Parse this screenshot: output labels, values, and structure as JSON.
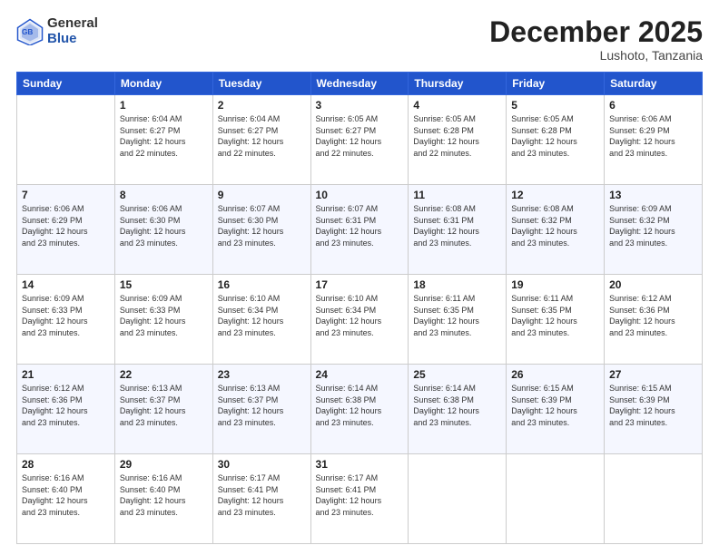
{
  "header": {
    "logo_general": "General",
    "logo_blue": "Blue",
    "month": "December 2025",
    "location": "Lushoto, Tanzania"
  },
  "weekdays": [
    "Sunday",
    "Monday",
    "Tuesday",
    "Wednesday",
    "Thursday",
    "Friday",
    "Saturday"
  ],
  "weeks": [
    [
      {
        "day": "",
        "info": ""
      },
      {
        "day": "1",
        "info": "Sunrise: 6:04 AM\nSunset: 6:27 PM\nDaylight: 12 hours\nand 22 minutes."
      },
      {
        "day": "2",
        "info": "Sunrise: 6:04 AM\nSunset: 6:27 PM\nDaylight: 12 hours\nand 22 minutes."
      },
      {
        "day": "3",
        "info": "Sunrise: 6:05 AM\nSunset: 6:27 PM\nDaylight: 12 hours\nand 22 minutes."
      },
      {
        "day": "4",
        "info": "Sunrise: 6:05 AM\nSunset: 6:28 PM\nDaylight: 12 hours\nand 22 minutes."
      },
      {
        "day": "5",
        "info": "Sunrise: 6:05 AM\nSunset: 6:28 PM\nDaylight: 12 hours\nand 23 minutes."
      },
      {
        "day": "6",
        "info": "Sunrise: 6:06 AM\nSunset: 6:29 PM\nDaylight: 12 hours\nand 23 minutes."
      }
    ],
    [
      {
        "day": "7",
        "info": "Sunrise: 6:06 AM\nSunset: 6:29 PM\nDaylight: 12 hours\nand 23 minutes."
      },
      {
        "day": "8",
        "info": "Sunrise: 6:06 AM\nSunset: 6:30 PM\nDaylight: 12 hours\nand 23 minutes."
      },
      {
        "day": "9",
        "info": "Sunrise: 6:07 AM\nSunset: 6:30 PM\nDaylight: 12 hours\nand 23 minutes."
      },
      {
        "day": "10",
        "info": "Sunrise: 6:07 AM\nSunset: 6:31 PM\nDaylight: 12 hours\nand 23 minutes."
      },
      {
        "day": "11",
        "info": "Sunrise: 6:08 AM\nSunset: 6:31 PM\nDaylight: 12 hours\nand 23 minutes."
      },
      {
        "day": "12",
        "info": "Sunrise: 6:08 AM\nSunset: 6:32 PM\nDaylight: 12 hours\nand 23 minutes."
      },
      {
        "day": "13",
        "info": "Sunrise: 6:09 AM\nSunset: 6:32 PM\nDaylight: 12 hours\nand 23 minutes."
      }
    ],
    [
      {
        "day": "14",
        "info": "Sunrise: 6:09 AM\nSunset: 6:33 PM\nDaylight: 12 hours\nand 23 minutes."
      },
      {
        "day": "15",
        "info": "Sunrise: 6:09 AM\nSunset: 6:33 PM\nDaylight: 12 hours\nand 23 minutes."
      },
      {
        "day": "16",
        "info": "Sunrise: 6:10 AM\nSunset: 6:34 PM\nDaylight: 12 hours\nand 23 minutes."
      },
      {
        "day": "17",
        "info": "Sunrise: 6:10 AM\nSunset: 6:34 PM\nDaylight: 12 hours\nand 23 minutes."
      },
      {
        "day": "18",
        "info": "Sunrise: 6:11 AM\nSunset: 6:35 PM\nDaylight: 12 hours\nand 23 minutes."
      },
      {
        "day": "19",
        "info": "Sunrise: 6:11 AM\nSunset: 6:35 PM\nDaylight: 12 hours\nand 23 minutes."
      },
      {
        "day": "20",
        "info": "Sunrise: 6:12 AM\nSunset: 6:36 PM\nDaylight: 12 hours\nand 23 minutes."
      }
    ],
    [
      {
        "day": "21",
        "info": "Sunrise: 6:12 AM\nSunset: 6:36 PM\nDaylight: 12 hours\nand 23 minutes."
      },
      {
        "day": "22",
        "info": "Sunrise: 6:13 AM\nSunset: 6:37 PM\nDaylight: 12 hours\nand 23 minutes."
      },
      {
        "day": "23",
        "info": "Sunrise: 6:13 AM\nSunset: 6:37 PM\nDaylight: 12 hours\nand 23 minutes."
      },
      {
        "day": "24",
        "info": "Sunrise: 6:14 AM\nSunset: 6:38 PM\nDaylight: 12 hours\nand 23 minutes."
      },
      {
        "day": "25",
        "info": "Sunrise: 6:14 AM\nSunset: 6:38 PM\nDaylight: 12 hours\nand 23 minutes."
      },
      {
        "day": "26",
        "info": "Sunrise: 6:15 AM\nSunset: 6:39 PM\nDaylight: 12 hours\nand 23 minutes."
      },
      {
        "day": "27",
        "info": "Sunrise: 6:15 AM\nSunset: 6:39 PM\nDaylight: 12 hours\nand 23 minutes."
      }
    ],
    [
      {
        "day": "28",
        "info": "Sunrise: 6:16 AM\nSunset: 6:40 PM\nDaylight: 12 hours\nand 23 minutes."
      },
      {
        "day": "29",
        "info": "Sunrise: 6:16 AM\nSunset: 6:40 PM\nDaylight: 12 hours\nand 23 minutes."
      },
      {
        "day": "30",
        "info": "Sunrise: 6:17 AM\nSunset: 6:41 PM\nDaylight: 12 hours\nand 23 minutes."
      },
      {
        "day": "31",
        "info": "Sunrise: 6:17 AM\nSunset: 6:41 PM\nDaylight: 12 hours\nand 23 minutes."
      },
      {
        "day": "",
        "info": ""
      },
      {
        "day": "",
        "info": ""
      },
      {
        "day": "",
        "info": ""
      }
    ]
  ]
}
